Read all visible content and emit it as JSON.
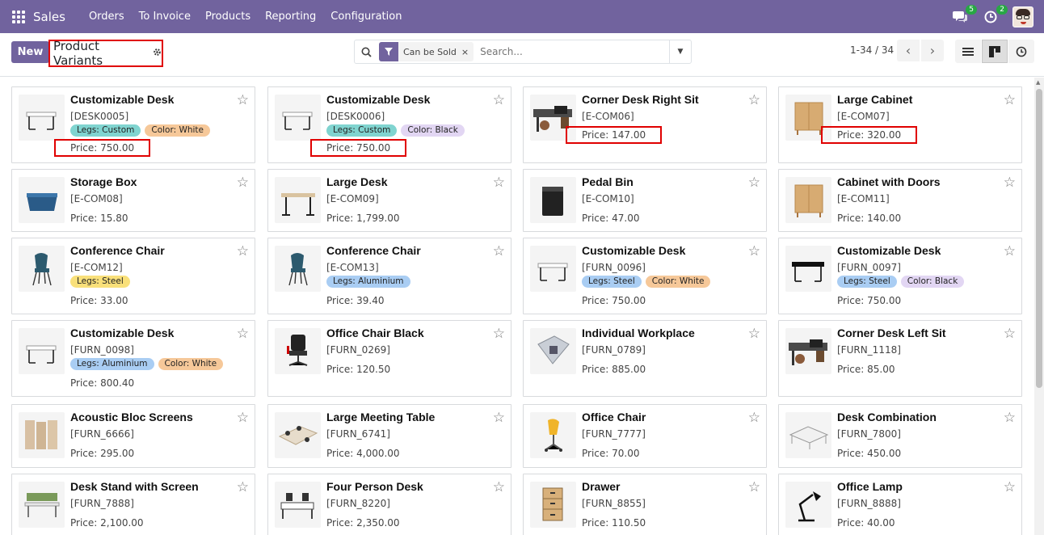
{
  "nav": {
    "app_name": "Sales",
    "menu": [
      "Orders",
      "To Invoice",
      "Products",
      "Reporting",
      "Configuration"
    ],
    "messages_badge": "5",
    "activities_badge": "2"
  },
  "control": {
    "new_label": "New",
    "title": "Product Variants",
    "facet": "Can be Sold",
    "facet_remove": "×",
    "search_placeholder": "Search...",
    "pager": "1-34 / 34",
    "prev_glyph": "‹",
    "next_glyph": "›"
  },
  "colors": {
    "brand": "#71639e",
    "highlight": "#e00000",
    "tag_legs": "#80d4d0",
    "tag_color_white": "#f6c899",
    "tag_color_black": "#e2d6f3",
    "tag_steel": "#f9e07a",
    "tag_aluminium": "#a9cdf3"
  },
  "products": [
    {
      "name": "Customizable Desk",
      "ref": "[DESK0005]",
      "tags": [
        {
          "text": "Legs: Custom",
          "kind": "legs_custom"
        },
        {
          "text": "Color: White",
          "kind": "white"
        }
      ],
      "price": "Price: 750.00",
      "highlight": true,
      "icon": "white-desk"
    },
    {
      "name": "Customizable Desk",
      "ref": "[DESK0006]",
      "tags": [
        {
          "text": "Legs: Custom",
          "kind": "legs_custom"
        },
        {
          "text": "Color: Black",
          "kind": "black"
        }
      ],
      "price": "Price: 750.00",
      "highlight": true,
      "icon": "white-desk"
    },
    {
      "name": "Corner Desk Right Sit",
      "ref": "[E-COM06]",
      "tags": [],
      "price": "Price: 147.00",
      "highlight": true,
      "icon": "office-scene"
    },
    {
      "name": "Large Cabinet",
      "ref": "[E-COM07]",
      "tags": [],
      "price": "Price: 320.00",
      "highlight": true,
      "icon": "wood-cabinet"
    },
    {
      "name": "Storage Box",
      "ref": "[E-COM08]",
      "tags": [],
      "price": "Price: 15.80",
      "highlight": false,
      "icon": "blue-box"
    },
    {
      "name": "Large Desk",
      "ref": "[E-COM09]",
      "tags": [],
      "price": "Price: 1,799.00",
      "highlight": false,
      "icon": "standing-desk"
    },
    {
      "name": "Pedal Bin",
      "ref": "[E-COM10]",
      "tags": [],
      "price": "Price: 47.00",
      "highlight": false,
      "icon": "black-bin"
    },
    {
      "name": "Cabinet with Doors",
      "ref": "[E-COM11]",
      "tags": [],
      "price": "Price: 140.00",
      "highlight": false,
      "icon": "wood-cabinet"
    },
    {
      "name": "Conference Chair",
      "ref": "[E-COM12]",
      "tags": [
        {
          "text": "Legs: Steel",
          "kind": "steel"
        }
      ],
      "price": "Price: 33.00",
      "highlight": false,
      "icon": "teal-chair"
    },
    {
      "name": "Conference Chair",
      "ref": "[E-COM13]",
      "tags": [
        {
          "text": "Legs: Aluminium",
          "kind": "aluminium"
        }
      ],
      "price": "Price: 39.40",
      "highlight": false,
      "icon": "teal-chair"
    },
    {
      "name": "Customizable Desk",
      "ref": "[FURN_0096]",
      "tags": [
        {
          "text": "Legs: Steel",
          "kind": "aluminium"
        },
        {
          "text": "Color: White",
          "kind": "white"
        }
      ],
      "price": "Price: 750.00",
      "highlight": false,
      "icon": "white-desk"
    },
    {
      "name": "Customizable Desk",
      "ref": "[FURN_0097]",
      "tags": [
        {
          "text": "Legs: Steel",
          "kind": "aluminium"
        },
        {
          "text": "Color: Black",
          "kind": "black"
        }
      ],
      "price": "Price: 750.00",
      "highlight": false,
      "icon": "black-desk"
    },
    {
      "name": "Customizable Desk",
      "ref": "[FURN_0098]",
      "tags": [
        {
          "text": "Legs: Aluminium",
          "kind": "aluminium"
        },
        {
          "text": "Color: White",
          "kind": "white"
        }
      ],
      "price": "Price: 800.40",
      "highlight": false,
      "icon": "white-desk"
    },
    {
      "name": "Office Chair Black",
      "ref": "[FURN_0269]",
      "tags": [],
      "price": "Price: 120.50",
      "highlight": false,
      "icon": "office-chair"
    },
    {
      "name": "Individual Workplace",
      "ref": "[FURN_0789]",
      "tags": [],
      "price": "Price: 885.00",
      "highlight": false,
      "icon": "workplace"
    },
    {
      "name": "Corner Desk Left Sit",
      "ref": "[FURN_1118]",
      "tags": [],
      "price": "Price: 85.00",
      "highlight": false,
      "icon": "office-scene"
    },
    {
      "name": "Acoustic Bloc Screens",
      "ref": "[FURN_6666]",
      "tags": [],
      "price": "Price: 295.00",
      "highlight": false,
      "icon": "screens"
    },
    {
      "name": "Large Meeting Table",
      "ref": "[FURN_6741]",
      "tags": [],
      "price": "Price: 4,000.00",
      "highlight": false,
      "icon": "meeting-table"
    },
    {
      "name": "Office Chair",
      "ref": "[FURN_7777]",
      "tags": [],
      "price": "Price: 70.00",
      "highlight": false,
      "icon": "yellow-chair"
    },
    {
      "name": "Desk Combination",
      "ref": "[FURN_7800]",
      "tags": [],
      "price": "Price: 450.00",
      "highlight": false,
      "icon": "desk-combo"
    },
    {
      "name": "Desk Stand with Screen",
      "ref": "[FURN_7888]",
      "tags": [],
      "price": "Price: 2,100.00",
      "highlight": false,
      "icon": "desk-screen"
    },
    {
      "name": "Four Person Desk",
      "ref": "[FURN_8220]",
      "tags": [],
      "price": "Price: 2,350.00",
      "highlight": false,
      "icon": "four-desk"
    },
    {
      "name": "Drawer",
      "ref": "[FURN_8855]",
      "tags": [],
      "price": "Price: 110.50",
      "highlight": false,
      "icon": "drawer"
    },
    {
      "name": "Office Lamp",
      "ref": "[FURN_8888]",
      "tags": [],
      "price": "Price: 40.00",
      "highlight": false,
      "icon": "lamp"
    }
  ]
}
